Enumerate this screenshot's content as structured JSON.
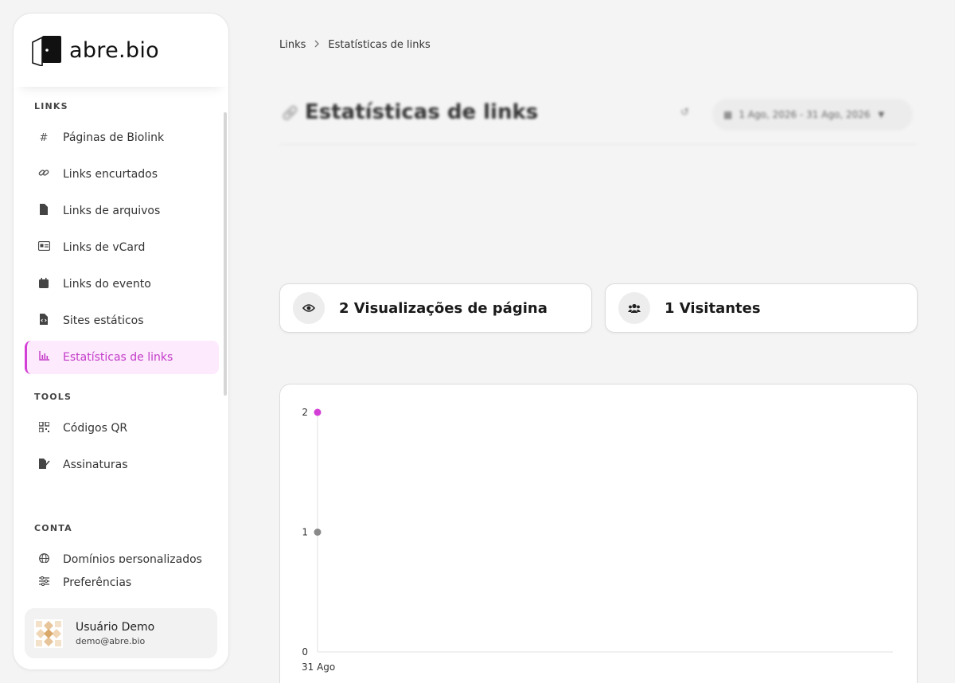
{
  "sidebar": {
    "logo_text": "abre.bio",
    "sections": {
      "links": "LINKS",
      "tools": "TOOLS",
      "conta": "CONTA"
    },
    "links_items": [
      {
        "label": "Páginas de Biolink",
        "icon": "hash-icon"
      },
      {
        "label": "Links encurtados",
        "icon": "link-icon"
      },
      {
        "label": "Links de arquivos",
        "icon": "file-icon"
      },
      {
        "label": "Links de vCard",
        "icon": "id-card-icon"
      },
      {
        "label": "Links do evento",
        "icon": "calendar-icon"
      },
      {
        "label": "Sites estáticos",
        "icon": "file-code-icon"
      },
      {
        "label": "Estatísticas de links",
        "icon": "chart-icon",
        "active": true
      }
    ],
    "tools_items": [
      {
        "label": "Códigos QR",
        "icon": "qr-code-icon"
      },
      {
        "label": "Assinaturas",
        "icon": "signature-icon"
      }
    ],
    "conta_items": [
      {
        "label": "Domínios personalizados",
        "icon": "globe-icon"
      }
    ],
    "preferences_label": "Preferências",
    "user": {
      "name": "Usuário Demo",
      "email": "demo@abre.bio"
    }
  },
  "breadcrumb": {
    "root": "Links",
    "current": "Estatísticas de links"
  },
  "header": {
    "title": "Estatísticas de links",
    "date_range": "1 Ago, 2026 - 31 Ago, 2026"
  },
  "stats": {
    "pageviews": "2 Visualizações de página",
    "visitors": "1 Visitantes"
  },
  "colors": {
    "accent": "#d33fd6",
    "accent_bg": "#fdeafd",
    "secondary_series": "#8a8a8a"
  },
  "chart_data": {
    "type": "line",
    "categories": [
      "31 Ago"
    ],
    "series": [
      {
        "values": [
          2
        ],
        "color": "#d33fd6"
      },
      {
        "values": [
          1
        ],
        "color": "#8a8a8a"
      }
    ],
    "yticks": [
      0,
      1,
      2
    ],
    "ylim": [
      0,
      2
    ],
    "grid": false
  }
}
